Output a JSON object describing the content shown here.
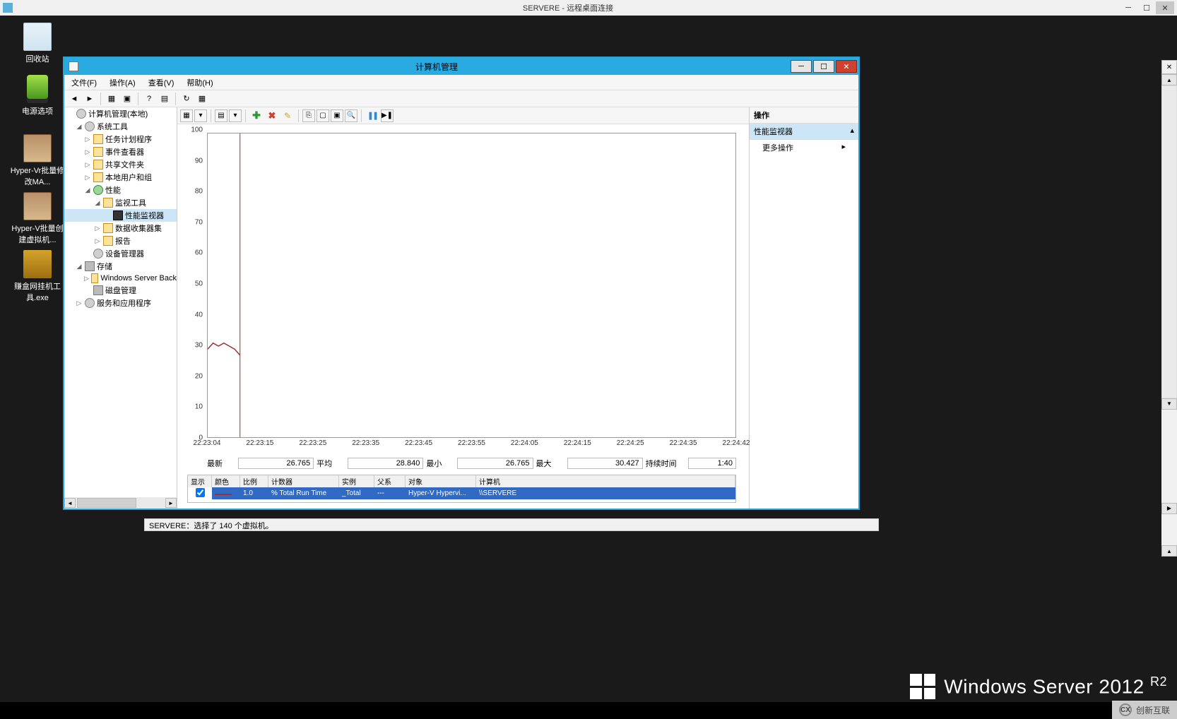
{
  "rdp": {
    "title": "SERVERE - 远程桌面连接",
    "min": "─",
    "max": "☐",
    "close": "✕"
  },
  "desktop": {
    "recycle": "回收站",
    "power": "电源选项",
    "rar1": "Hyper-Vr批量修改MA...",
    "rar2": "Hyper-V批量创建虚拟机...",
    "exe1": "赚盒网挂机工具.exe"
  },
  "cm": {
    "title": "计算机管理",
    "menu": {
      "file": "文件(F)",
      "action": "操作(A)",
      "view": "查看(V)",
      "help": "帮助(H)"
    },
    "tree": {
      "root": "计算机管理(本地)",
      "n_systools": "系统工具",
      "n_sched": "任务计划程序",
      "n_evt": "事件查看器",
      "n_share": "共享文件夹",
      "n_local": "本地用户和组",
      "n_perf": "性能",
      "n_montools": "监视工具",
      "n_perfmon": "性能监视器",
      "n_dcs": "数据收集器集",
      "n_reports": "报告",
      "n_devmgr": "设备管理器",
      "n_storage": "存储",
      "n_wsb": "Windows Server Back",
      "n_diskmgr": "磁盘管理",
      "n_svc": "服务和应用程序"
    },
    "actions": {
      "hdr": "操作",
      "section": "性能监视器",
      "more": "更多操作"
    }
  },
  "chart_data": {
    "type": "line",
    "title": "",
    "ylabel": "",
    "xlabel": "",
    "ylim": [
      0,
      100
    ],
    "y_ticks": [
      0,
      10,
      20,
      30,
      40,
      50,
      60,
      70,
      80,
      90,
      100
    ],
    "x_ticks": [
      "22:23:04",
      "22:23:15",
      "22:23:25",
      "22:23:35",
      "22:23:45",
      "22:23:55",
      "22:24:05",
      "22:24:15",
      "22:24:25",
      "22:24:35",
      "22:24:42"
    ],
    "series": [
      {
        "name": "% Total Run Time",
        "color": "#a03030",
        "x": [
          "22:23:04",
          "22:23:05",
          "22:23:06",
          "22:23:07",
          "22:23:08",
          "22:23:09",
          "22:23:10"
        ],
        "values": [
          29,
          31,
          30,
          31,
          30,
          29,
          27
        ]
      }
    ],
    "cursor_x": "22:23:10"
  },
  "stats": {
    "latest_l": "最新",
    "latest_v": "26.765",
    "avg_l": "平均",
    "avg_v": "28.840",
    "min_l": "最小",
    "min_v": "26.765",
    "max_l": "最大",
    "max_v": "30.427",
    "dur_l": "持续时间",
    "dur_v": "1:40"
  },
  "counters": {
    "hdr": {
      "show": "显示",
      "color": "颜色",
      "scale": "比例",
      "counter": "计数器",
      "instance": "实例",
      "parent": "父系",
      "object": "对象",
      "computer": "计算机"
    },
    "row": {
      "scale": "1.0",
      "counter": "% Total Run Time",
      "instance": "_Total",
      "parent": "---",
      "object": "Hyper-V Hypervi...",
      "computer": "\\\\SERVERE"
    }
  },
  "status": "SERVERE：选择了 140 个虚拟机。",
  "watermark": {
    "brand": "Windows Server 2012",
    "suffix": "R2"
  },
  "corner": "创新互联",
  "right_tab": "✕"
}
